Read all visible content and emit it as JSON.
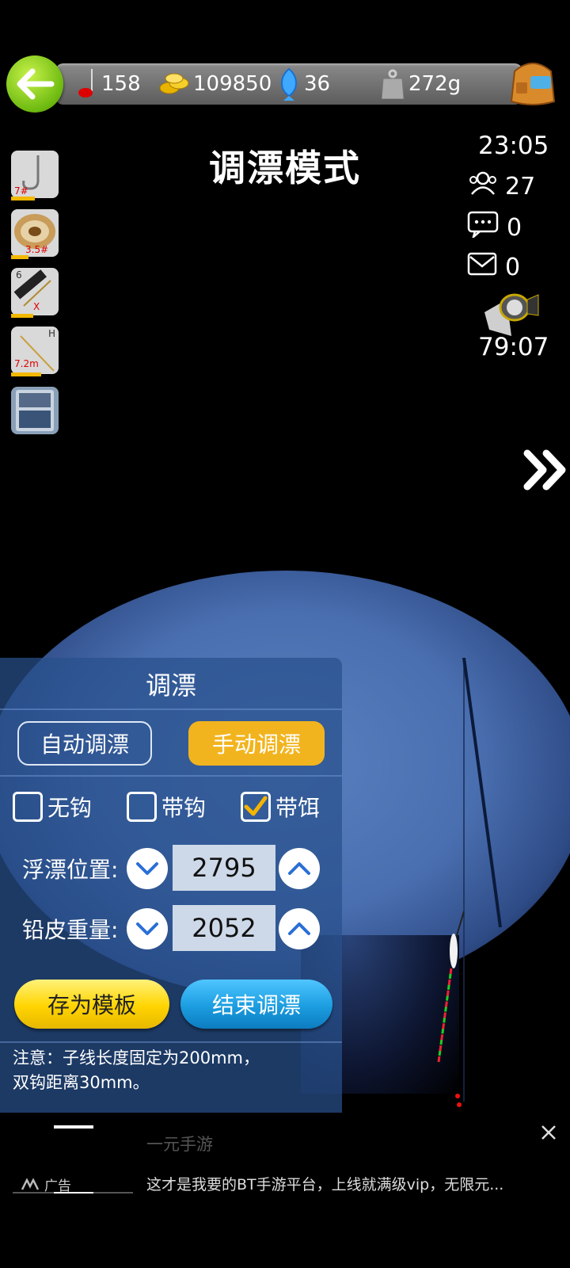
{
  "top_bar": {
    "hooks_count": "158",
    "coins": "109850",
    "fish_count": "36",
    "weight": "272g"
  },
  "title": "调漂模式",
  "right_stats": {
    "clock": "23:05",
    "online_users": "27",
    "messages": "0",
    "mail": "0",
    "lamp_timer": "79:07"
  },
  "gear": {
    "hook_label": "7#",
    "line_label": "3.5#",
    "float_top": "6",
    "float_mark": "X",
    "rod_label": "7.2m",
    "rod_mark": "H"
  },
  "panel": {
    "heading": "调漂",
    "auto_btn": "自动调漂",
    "manual_btn": "手动调漂",
    "options": [
      {
        "label": "无钩",
        "checked": false
      },
      {
        "label": "带钩",
        "checked": false
      },
      {
        "label": "带饵",
        "checked": true
      }
    ],
    "float_pos_label": "浮漂位置:",
    "float_pos_value": "2795",
    "sinker_label": "铅皮重量:",
    "sinker_value": "2052",
    "save_btn": "存为模板",
    "end_btn": "结束调漂",
    "note_line1": "注意：子线长度固定为200mm，",
    "note_line2": "双钩距离30mm。"
  },
  "ad": {
    "app_name": "一元手游",
    "ad_tag": "广告",
    "text": "这才是我要的BT手游平台，上线就满级vip，无限元..."
  },
  "colors": {
    "manual_btn": "#f2b41e",
    "save_btn": "#ffd400",
    "end_btn": "#1b9de0",
    "checkbox_tick": "#f5b400"
  }
}
